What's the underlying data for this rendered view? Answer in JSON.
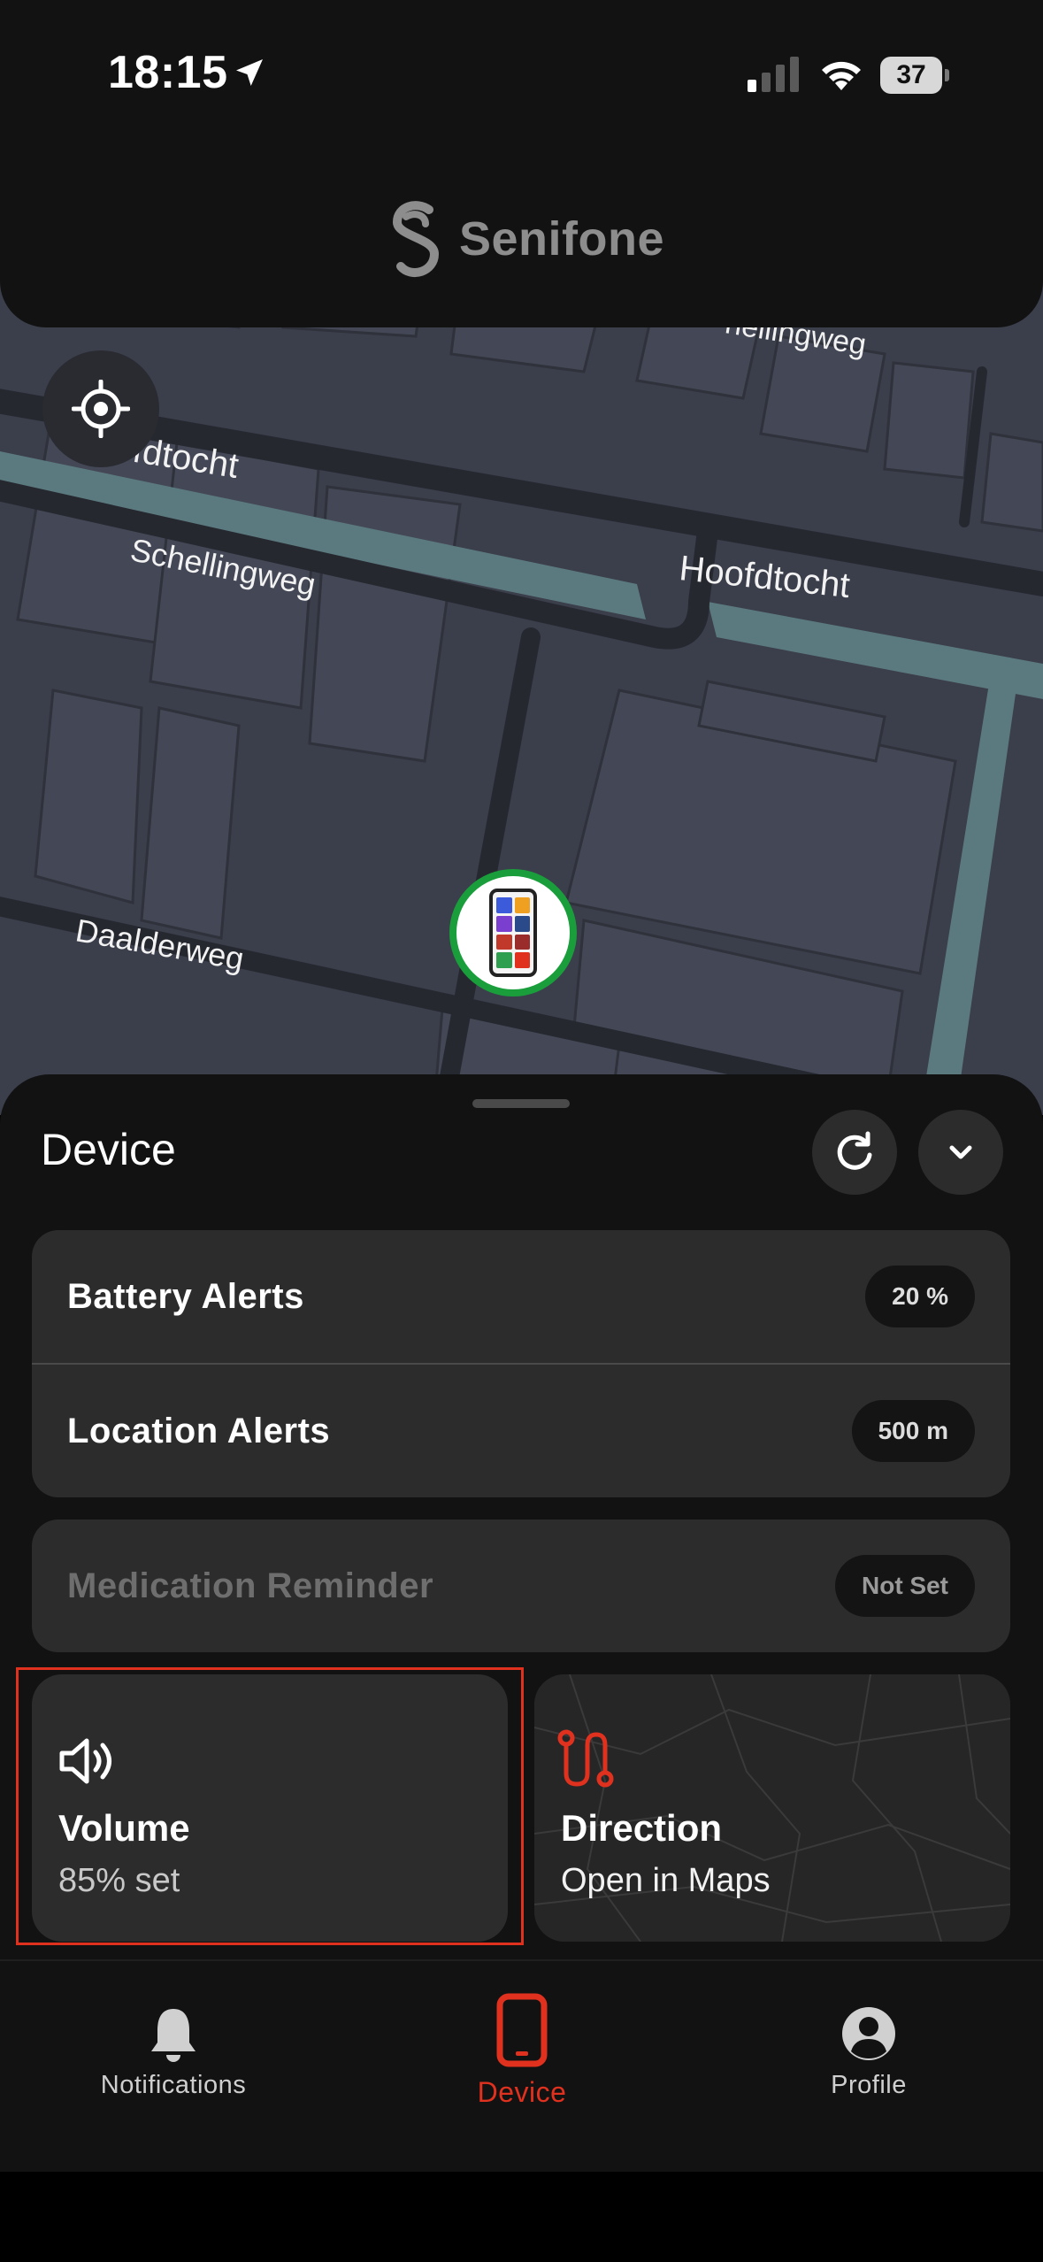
{
  "status_bar": {
    "time": "18:15",
    "battery_level": "37"
  },
  "brand": {
    "name": "Senifone"
  },
  "map": {
    "labels": [
      "Hoofdtocht",
      "Schellingweg",
      "Hoofdtocht",
      "Daalderweg",
      "hellingweg"
    ],
    "recenter_icon": "crosshair-icon",
    "device_marker_icon": "phone-icon"
  },
  "sheet": {
    "title": "Device",
    "refresh_icon": "refresh-icon",
    "collapse_icon": "chevron-down-icon",
    "alerts": [
      {
        "label": "Battery Alerts",
        "value": "20 %"
      },
      {
        "label": "Location Alerts",
        "value": "500 m"
      }
    ],
    "medication": {
      "label": "Medication Reminder",
      "value": "Not Set"
    },
    "volume": {
      "icon": "speaker-icon",
      "title": "Volume",
      "subtitle": "85% set"
    },
    "direction": {
      "icon": "route-icon",
      "title": "Direction",
      "subtitle": "Open in Maps"
    }
  },
  "tabs": [
    {
      "label": "Notifications",
      "icon": "bell-icon",
      "active": false
    },
    {
      "label": "Device",
      "icon": "phone-icon",
      "active": true
    },
    {
      "label": "Profile",
      "icon": "user-icon",
      "active": false
    }
  ],
  "colors": {
    "accent": "#e0311f",
    "pin_ring": "#1a9e3c",
    "sheet_bg": "#121212",
    "card_bg": "#2c2c2c"
  }
}
